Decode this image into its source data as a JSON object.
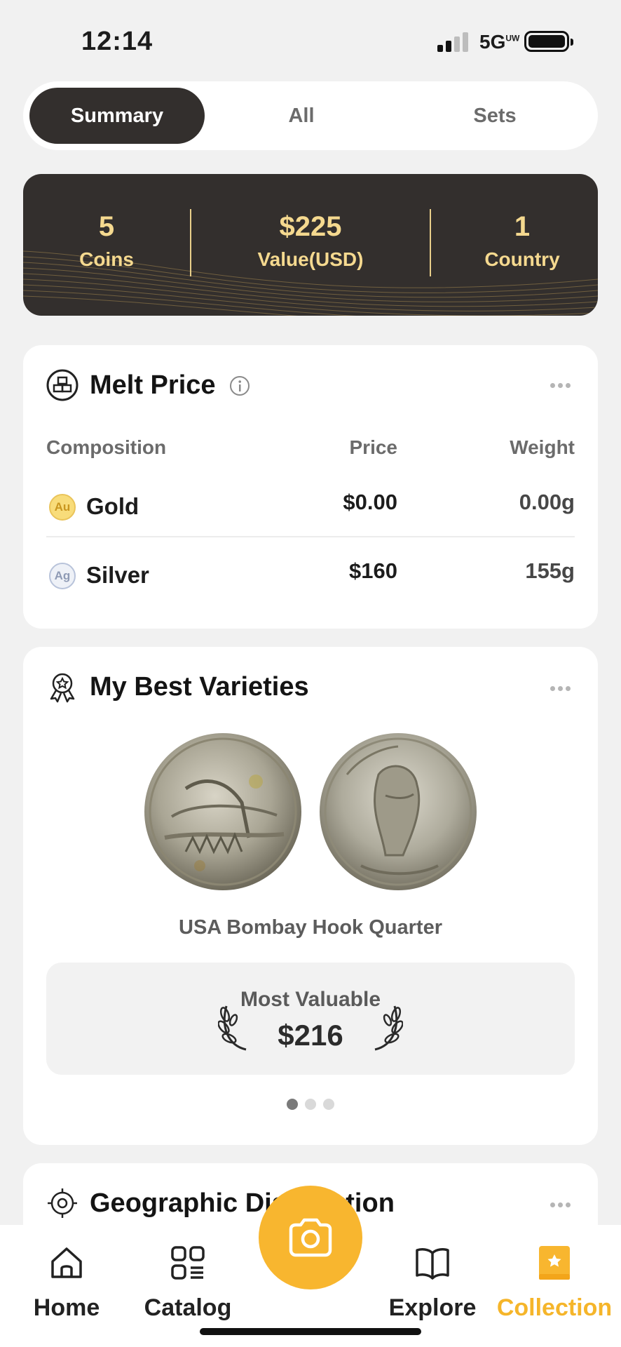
{
  "status_bar": {
    "time": "12:14",
    "network": "5G",
    "network_sup": "UW"
  },
  "tabs": [
    {
      "label": "Summary",
      "active": true
    },
    {
      "label": "All",
      "active": false
    },
    {
      "label": "Sets",
      "active": false
    }
  ],
  "summary": {
    "coins": {
      "value": "5",
      "label": "Coins"
    },
    "value": {
      "value": "$225",
      "label": "Value(USD)"
    },
    "country": {
      "value": "1",
      "label": "Country"
    }
  },
  "melt_price": {
    "title": "Melt Price",
    "headers": {
      "composition": "Composition",
      "price": "Price",
      "weight": "Weight"
    },
    "rows": [
      {
        "badge": "Au",
        "name": "Gold",
        "price": "$0.00",
        "weight": "0.00g"
      },
      {
        "badge": "Ag",
        "name": "Silver",
        "price": "$160",
        "weight": "155g"
      }
    ]
  },
  "varieties": {
    "title": "My Best Varieties",
    "coin_name": "USA Bombay Hook Quarter",
    "most_valuable_label": "Most Valuable",
    "most_valuable_value": "$216",
    "page_index": 0,
    "page_count": 3
  },
  "geo": {
    "title": "Geographic Distribution"
  },
  "nav": {
    "home": "Home",
    "catalog": "Catalog",
    "explore": "Explore",
    "collection": "Collection"
  },
  "colors": {
    "accent": "#f8b62f",
    "dark": "#332f2d",
    "gold_text": "#f5d98f"
  }
}
